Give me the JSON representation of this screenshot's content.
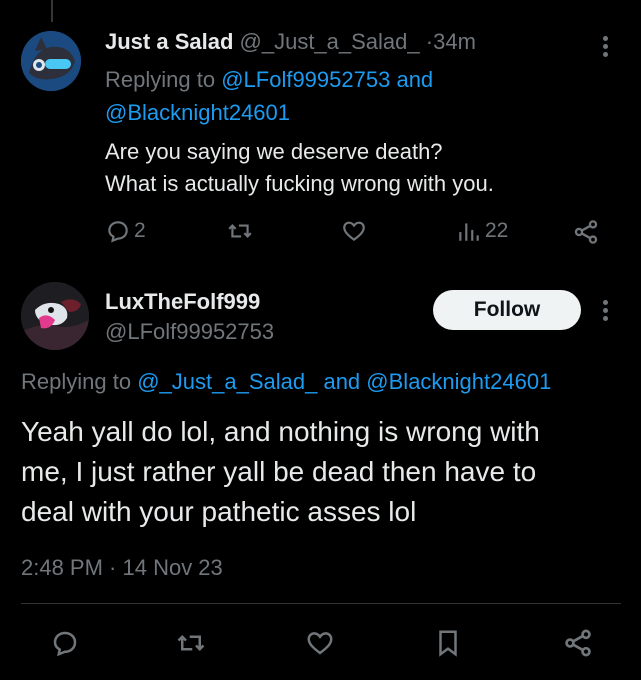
{
  "reply_tweet": {
    "display_name": "Just a Salad",
    "handle": "@_Just_a_Salad_",
    "separator": "·",
    "time": "34m",
    "replying_prefix": "Replying to",
    "replying_user1": "@LFolf99952753",
    "replying_and": "and",
    "replying_user2": "@Blacknight24601",
    "text_line1": "Are you saying we deserve death?",
    "text_line2": "What is actually fucking wrong with you.",
    "reply_count": "2",
    "views_count": "22"
  },
  "main_tweet": {
    "display_name": "LuxTheFolf999",
    "handle": "@LFolf99952753",
    "follow_label": "Follow",
    "replying_prefix": "Replying to",
    "replying_user1": "@_Just_a_Salad_",
    "replying_and": "and",
    "replying_user2": "@Blacknight24601",
    "text_line1": "Yeah yall do lol, and nothing is wrong with",
    "text_line2": "me, I just rather yall be dead then have to",
    "text_line3": "deal with your pathetic asses lol",
    "timestamp": "2:48 PM · 14 Nov 23"
  },
  "colors": {
    "background": "#000000",
    "text": "#e7e9ea",
    "muted": "#71767b",
    "link": "#1d9bf0",
    "follow_bg": "#eff3f4"
  },
  "icons": [
    "reply-icon",
    "retweet-icon",
    "like-icon",
    "views-icon",
    "share-icon",
    "bookmark-icon",
    "more-icon"
  ]
}
